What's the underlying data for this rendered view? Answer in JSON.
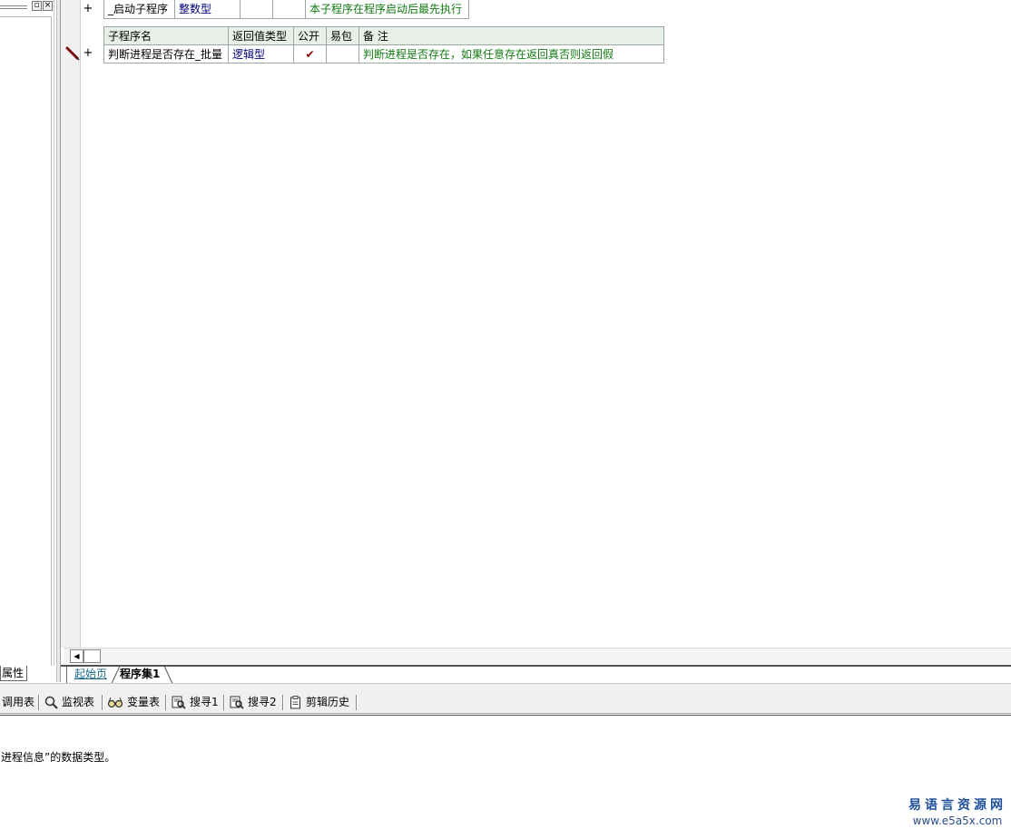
{
  "left_panel": {
    "tab_label": "属性"
  },
  "editor": {
    "sub1": {
      "name": "_启动子程序",
      "type": "整数型",
      "note": "本子程序在程序启动后最先执行"
    },
    "sub2": {
      "headers": [
        "子程序名",
        "返回值类型",
        "公开",
        "易包",
        "备 注"
      ],
      "name": "判断进程是否存在_批量",
      "type": "逻辑型",
      "public_mark": "✔",
      "note": "判断进程是否存在，如果任意存在返回真否则返回假"
    },
    "plus": "+"
  },
  "page_tabs": [
    "起始页",
    "程序集1"
  ],
  "toolbar": [
    "调用表",
    "监视表",
    "变量表",
    "搜寻1",
    "搜寻2",
    "剪辑历史"
  ],
  "status": "进程信息”的数据类型。",
  "watermark": {
    "cn": "易语言资源网",
    "url": "www.e5a5x.com"
  },
  "colors": {
    "type": "#00007a",
    "note": "#117a11",
    "header_bg": "#e8efe8",
    "watermark": "#1f4f9a"
  }
}
